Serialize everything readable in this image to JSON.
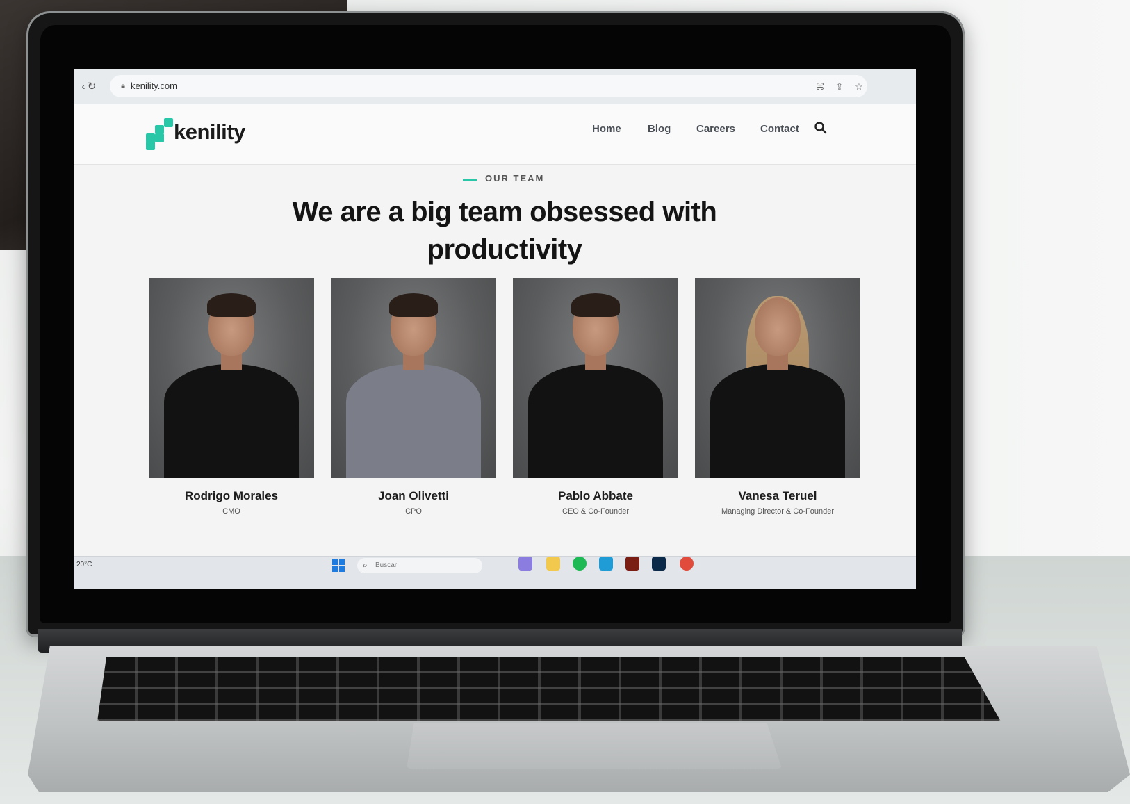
{
  "browser": {
    "url": "kenility.com",
    "icons": [
      "back-arrow-icon",
      "reload-icon",
      "lock-icon",
      "translate-icon",
      "share-icon",
      "bookmark-star-icon"
    ]
  },
  "site": {
    "logo_text": "kenility",
    "nav": {
      "home": "Home",
      "blog": "Blog",
      "careers": "Careers",
      "contact": "Contact"
    },
    "accent": "#27c7a8"
  },
  "team": {
    "eyebrow": "OUR TEAM",
    "headline": "We are a big team obsessed with productivity",
    "members": [
      {
        "name": "Rodrigo Morales",
        "role": "CMO"
      },
      {
        "name": "Joan Olivetti",
        "role": "CPO"
      },
      {
        "name": "Pablo Abbate",
        "role": "CEO & Co-Founder"
      },
      {
        "name": "Vanesa Teruel",
        "role": "Managing Director & Co-Founder"
      }
    ]
  },
  "taskbar": {
    "weather": "20°C",
    "search_placeholder": "Buscar"
  }
}
